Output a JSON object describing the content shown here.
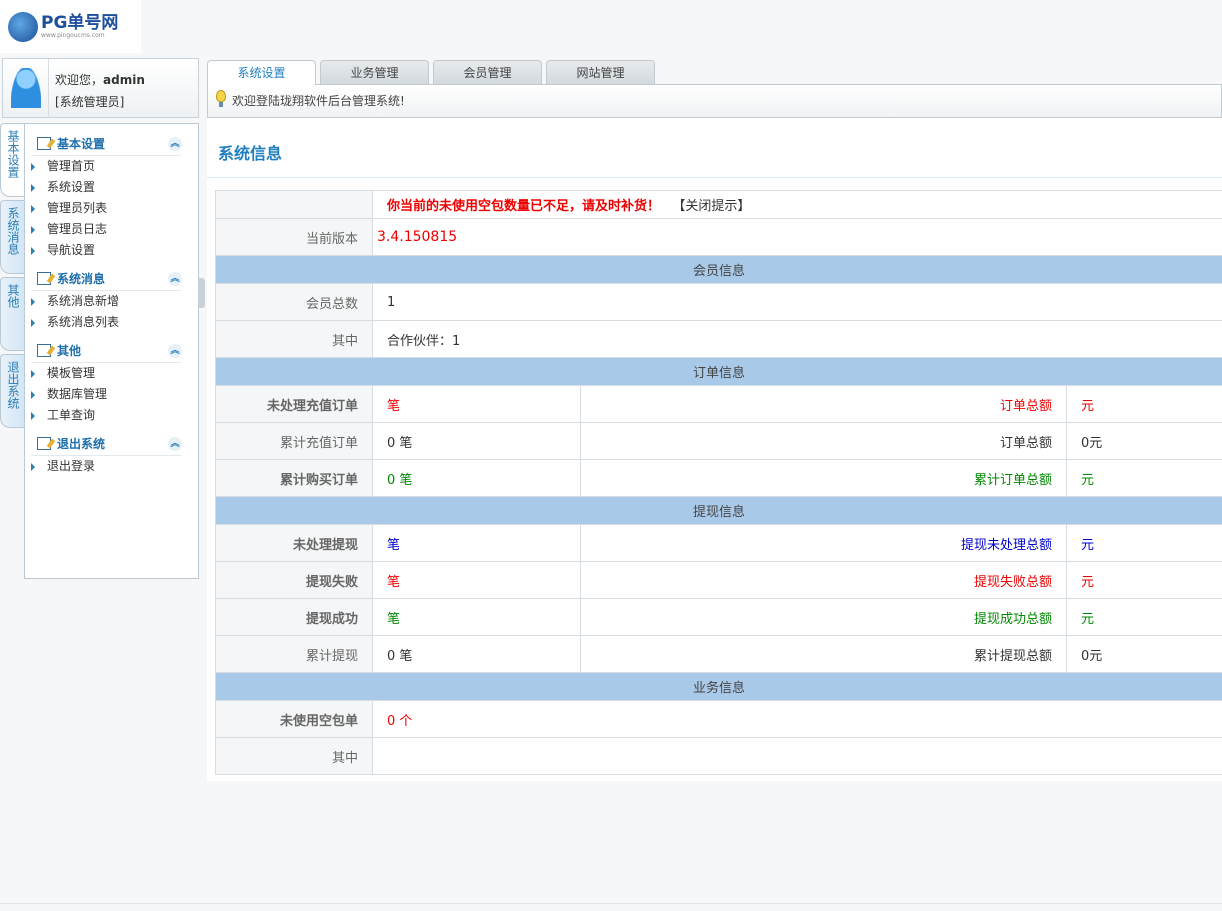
{
  "logo": {
    "name": "PG单号网",
    "url": "www.pingoucms.com"
  },
  "user": {
    "greeting": "欢迎您，",
    "name": "admin",
    "role": "[系统管理员]"
  },
  "side_tabs": [
    "基本设置",
    "系统消息",
    "其他",
    "退出系统"
  ],
  "menu": [
    {
      "title": "基本设置",
      "items": [
        "管理首页",
        "系统设置",
        "管理员列表",
        "管理员日志",
        "导航设置"
      ]
    },
    {
      "title": "系统消息",
      "items": [
        "系统消息新增",
        "系统消息列表"
      ]
    },
    {
      "title": "其他",
      "items": [
        "模板管理",
        "数据库管理",
        "工单查询"
      ]
    },
    {
      "title": "退出系统",
      "items": [
        "退出登录"
      ]
    }
  ],
  "tabs": [
    "系统设置",
    "业务管理",
    "会员管理",
    "网站管理"
  ],
  "welcome": "欢迎登陆珑翔软件后台管理系统!",
  "page_title": "系统信息",
  "alert": {
    "text": "你当前的未使用空包数量已不足，请及时补货！",
    "close": "【关闭提示】"
  },
  "version": {
    "label": "当前版本",
    "value": "3.4.150815"
  },
  "member": {
    "section": "会员信息",
    "total_label": "会员总数",
    "total": "1",
    "of_label": "其中",
    "of_value": "合作伙伴：1"
  },
  "orders": {
    "section": "订单信息",
    "rows": [
      {
        "label": "未处理充值订单",
        "count": "笔",
        "amount_label": "订单总额",
        "amount": "元",
        "color": "red"
      },
      {
        "label": "累计充值订单",
        "count": "0 笔",
        "amount_label": "订单总额",
        "amount": "0元",
        "color": ""
      },
      {
        "label": "累计购买订单",
        "count": "0 笔",
        "amount_label": "累计订单总额",
        "amount": "元",
        "color": "grn"
      }
    ]
  },
  "withdraw": {
    "section": "提现信息",
    "rows": [
      {
        "label": "未处理提现",
        "count": "笔",
        "amount_label": "提现未处理总额",
        "amount": "元",
        "color": "blu"
      },
      {
        "label": "提现失败",
        "count": "笔",
        "amount_label": "提现失败总额",
        "amount": "元",
        "color": "red"
      },
      {
        "label": "提现成功",
        "count": "笔",
        "amount_label": "提现成功总额",
        "amount": "元",
        "color": "grn"
      },
      {
        "label": "累计提现",
        "count": "0 笔",
        "amount_label": "累计提现总额",
        "amount": "0元",
        "color": ""
      }
    ]
  },
  "business": {
    "section": "业务信息",
    "unused_label": "未使用空包单",
    "unused": "0 个",
    "of_label": "其中",
    "of_value": ""
  }
}
